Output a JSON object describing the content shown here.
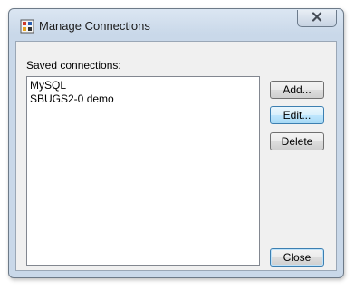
{
  "window": {
    "title": "Manage Connections"
  },
  "dialog": {
    "saved_label": "Saved connections:",
    "connections": [
      "MySQL",
      "SBUGS2-0 demo"
    ],
    "buttons": {
      "add": "Add...",
      "edit": "Edit...",
      "delete": "Delete",
      "close": "Close"
    }
  },
  "icons": {
    "app": "app-icon",
    "close": "close-icon"
  },
  "colors": {
    "titlebar": "#c9d8e9",
    "close_x": "#444b55",
    "focus_border": "#3c7fb1"
  }
}
